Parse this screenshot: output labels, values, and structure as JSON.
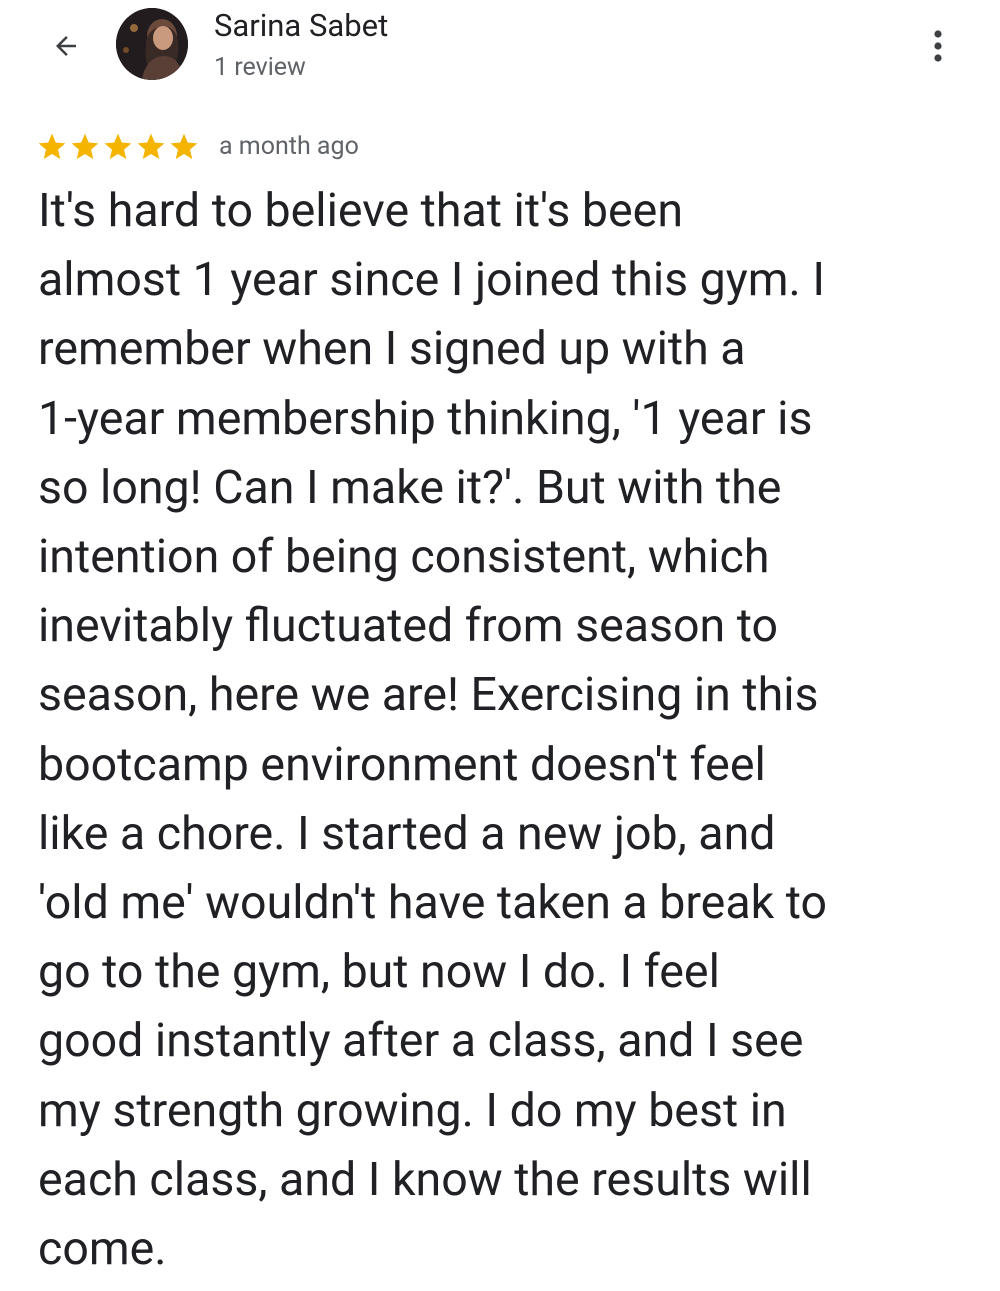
{
  "header": {
    "back_icon": "arrow-back-icon",
    "avatar_icon": "user-avatar",
    "more_icon": "more-vertical-icon"
  },
  "reviewer": {
    "name": "Sarina Sabet",
    "review_count": "1 review"
  },
  "review": {
    "rating": 5,
    "rating_max": 5,
    "star_color": "#f4b400",
    "time_ago": "a month ago",
    "text_lines": [
      "It's hard to believe that it's been",
      "almost 1 year since I joined this gym. I",
      "remember when I signed up with a",
      "1-year membership thinking, '1 year is",
      "so long! Can I make it?'. But with the",
      "intention of being consistent, which",
      "inevitably fluctuated from season to",
      "season, here we are! Exercising in this",
      "bootcamp environment doesn't feel",
      "like a chore. I started a new job, and",
      "'old me' wouldn't have taken a break to",
      "go to the gym, but now I do. I feel",
      "good instantly after a class, and I see",
      "my strength growing. I do my best in",
      "each class, and I know the results will",
      "come."
    ]
  }
}
